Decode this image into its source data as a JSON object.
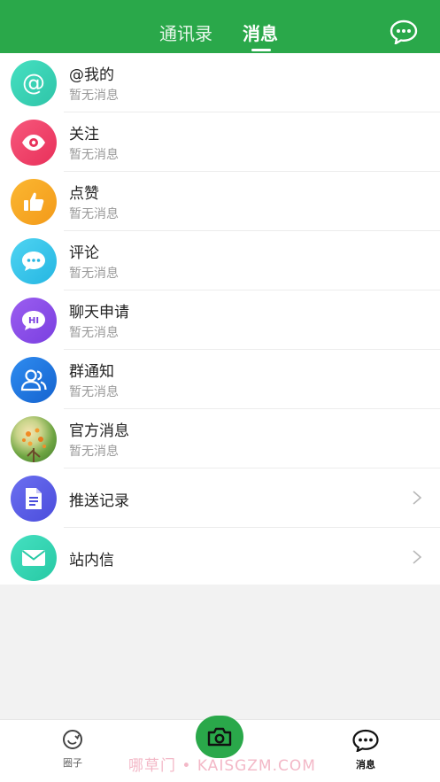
{
  "header": {
    "tabs": [
      {
        "label": "通讯录",
        "active": false
      },
      {
        "label": "消息",
        "active": true
      }
    ],
    "chat_icon": "chat-bubble-icon",
    "color": "#2aa84a"
  },
  "messages": [
    {
      "title": "@我的",
      "subtitle": "暂无消息",
      "icon": "at-icon",
      "color": "#3ad6b6"
    },
    {
      "title": "关注",
      "subtitle": "暂无消息",
      "icon": "eye-icon",
      "color": "#f2456b"
    },
    {
      "title": "点赞",
      "subtitle": "暂无消息",
      "icon": "thumbs-up-icon",
      "color": "#f9a825"
    },
    {
      "title": "评论",
      "subtitle": "暂无消息",
      "icon": "comment-icon",
      "color": "#35c6ea"
    },
    {
      "title": "聊天申请",
      "subtitle": "暂无消息",
      "icon": "hi-chat-icon",
      "color": "#8a4dea"
    },
    {
      "title": "群通知",
      "subtitle": "暂无消息",
      "icon": "group-icon",
      "color": "#1e78e0"
    },
    {
      "title": "官方消息",
      "subtitle": "暂无消息",
      "icon": "official-avatar",
      "color": "#7fb24a"
    },
    {
      "title": "推送记录",
      "icon": "document-icon",
      "color": "#5d5fe8"
    },
    {
      "title": "站内信",
      "icon": "mail-icon",
      "color": "#35d6b3"
    }
  ],
  "tabbar": {
    "circle_label": "圈子",
    "circle_icon": "circle-icon",
    "camera_icon": "camera-icon",
    "messages_label": "消息",
    "messages_icon": "chat-dots-icon"
  },
  "watermark": "哪草门 • KAISGZM.COM"
}
